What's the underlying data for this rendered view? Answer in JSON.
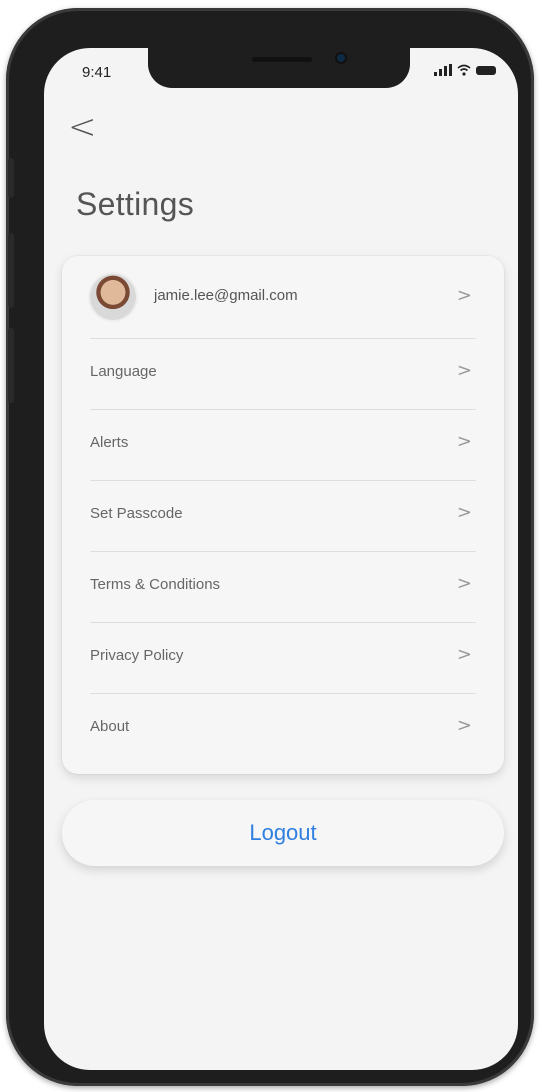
{
  "status_bar": {
    "time": "9:41"
  },
  "nav": {
    "back_glyph": "<"
  },
  "page": {
    "title": "Settings"
  },
  "account": {
    "email": "jamie.lee@gmail.com"
  },
  "settings_items": [
    {
      "label": "Language"
    },
    {
      "label": "Alerts"
    },
    {
      "label": "Set Passcode"
    },
    {
      "label": "Terms & Conditions"
    },
    {
      "label": "Privacy Policy"
    },
    {
      "label": "About"
    }
  ],
  "chevron": ">",
  "logout": {
    "label": "Logout"
  },
  "colors": {
    "accent": "#2f7fe0",
    "background": "#f4f4f4",
    "frame": "#1e1e1e"
  }
}
